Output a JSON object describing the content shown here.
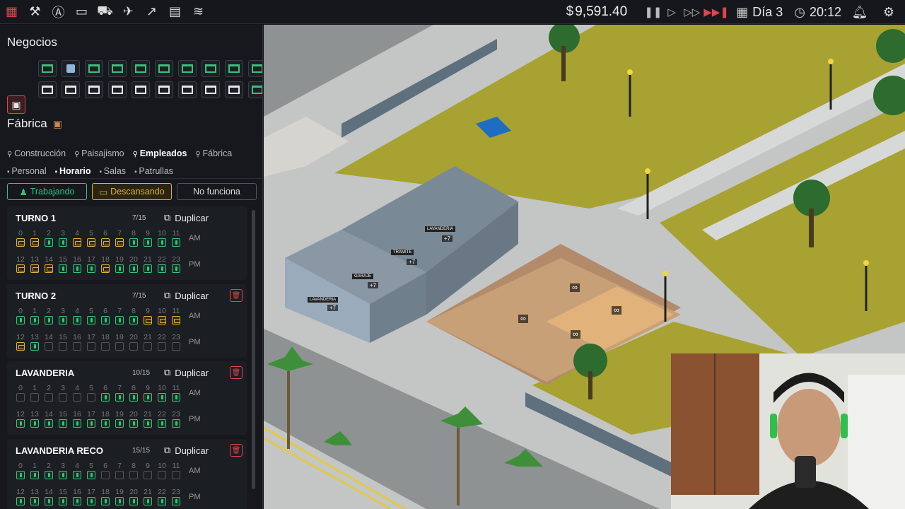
{
  "topbar": {
    "icons": [
      "grid-icon",
      "tools-icon",
      "font-icon",
      "briefcase-icon",
      "truck-icon",
      "plane-icon",
      "chart-icon",
      "ledger-icon",
      "layers-icon"
    ],
    "money": "9,591.40",
    "money_symbol": "$",
    "day": "Día 3",
    "time": "20:12",
    "speed_active": "fastest"
  },
  "sidebar": {
    "businesses_title": "Negocios",
    "factory_title": "Fábrica",
    "main_tabs": [
      {
        "label": "Construcción",
        "icon": "wrench-icon",
        "active": false
      },
      {
        "label": "Paisajismo",
        "icon": "brush-icon",
        "active": false
      },
      {
        "label": "Empleados",
        "icon": "people-icon",
        "active": true
      },
      {
        "label": "Fábrica",
        "icon": "factory-icon",
        "active": false
      }
    ],
    "sub_tabs": [
      {
        "label": "Personal",
        "icon": "person-icon",
        "active": false
      },
      {
        "label": "Horario",
        "icon": "calendar-icon",
        "active": true
      },
      {
        "label": "Salas",
        "icon": "room-icon",
        "active": false
      },
      {
        "label": "Patrullas",
        "icon": "patrol-icon",
        "active": false
      }
    ],
    "legend": {
      "working": "Trabajando",
      "resting": "Descansando",
      "not_working": "No funciona"
    },
    "duplicate_label": "Duplicar",
    "am": "AM",
    "pm": "PM",
    "am_hours": [
      "0",
      "1",
      "2",
      "3",
      "4",
      "5",
      "6",
      "7",
      "8",
      "9",
      "10",
      "11"
    ],
    "pm_hours": [
      "12",
      "13",
      "14",
      "15",
      "16",
      "17",
      "18",
      "19",
      "20",
      "21",
      "22",
      "23"
    ],
    "shifts": [
      {
        "name": "TURNO 1",
        "count": "7/15",
        "deletable": false,
        "am": "rrwwrrrrwwww",
        "pm": "rrrwwwrwwwww"
      },
      {
        "name": "TURNO 2",
        "count": "7/15",
        "deletable": true,
        "am": "wwwwwwwwwrrr",
        "pm": "rwn nnnnnnnnn"
      },
      {
        "name": "LAVANDERIA",
        "count": "10/15",
        "deletable": true,
        "am": "nnnnnnwwwwww",
        "pm": "wwwwwwwwwwww"
      },
      {
        "name": "LAVANDERIA RECO",
        "count": "15/15",
        "deletable": true,
        "am": "wwwwwwnnnnnn",
        "pm": "wwwwwwwwwwww"
      }
    ]
  },
  "game": {
    "rooms": [
      {
        "label": "LAVANDERIA",
        "badge": "+7"
      },
      {
        "label": "TRAMITE",
        "badge": "+7"
      },
      {
        "label": "GARAJE",
        "badge": "+7"
      },
      {
        "label": "LAVANDERIA",
        "badge": "+7"
      }
    ],
    "infinity_badges": [
      "∞",
      "∞",
      "∞",
      "∞"
    ]
  }
}
